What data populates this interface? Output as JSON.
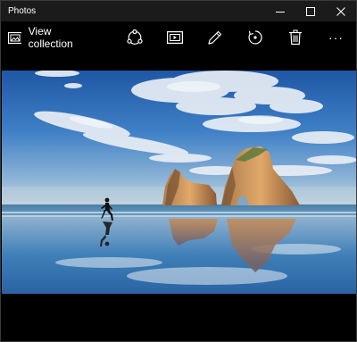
{
  "window": {
    "title": "Photos"
  },
  "toolbar": {
    "view_collection_label": "View collection",
    "more_label": "···"
  },
  "photo": {
    "alt": "Beach with sea stacks and a runner reflected on wet sand"
  },
  "colors": {
    "titlebar": "#1b1b1b",
    "background": "#000000",
    "icon": "#ffffff"
  }
}
